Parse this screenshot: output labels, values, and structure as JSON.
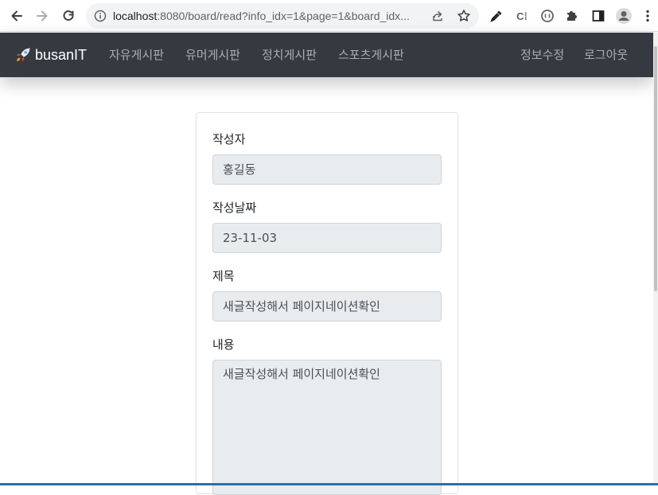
{
  "browser": {
    "url_host": "localhost",
    "url_path": ":8080/board/read?info_idx=1&page=1&board_idx..."
  },
  "navbar": {
    "brand": "busanIT",
    "links": [
      "자유게시판",
      "유머게시판",
      "정치게시판",
      "스포츠게시판"
    ],
    "right_links": [
      "정보수정",
      "로그아웃"
    ]
  },
  "form": {
    "writer_label": "작성자",
    "writer_value": "홍길동",
    "date_label": "작성날짜",
    "date_value": "23-11-03",
    "subject_label": "제목",
    "subject_value": "새글작성해서 페이지네이션확인",
    "content_label": "내용",
    "content_value": "새글작성해서 페이지네이션확인"
  },
  "colors": {
    "navbar_bg": "#343a40",
    "field_bg": "#e9ecef"
  },
  "icons": {
    "back": "arrow-left-icon",
    "forward": "arrow-right-icon",
    "reload": "reload-icon",
    "site_info": "info-icon",
    "share": "share-icon",
    "bookmark": "star-icon",
    "eyedropper": "eyedropper-icon",
    "extension_puzzle": "puzzle-icon",
    "side_panel": "side-panel-icon",
    "profile": "profile-icon",
    "menu": "kebab-menu-icon",
    "brand": "rocket-icon"
  }
}
